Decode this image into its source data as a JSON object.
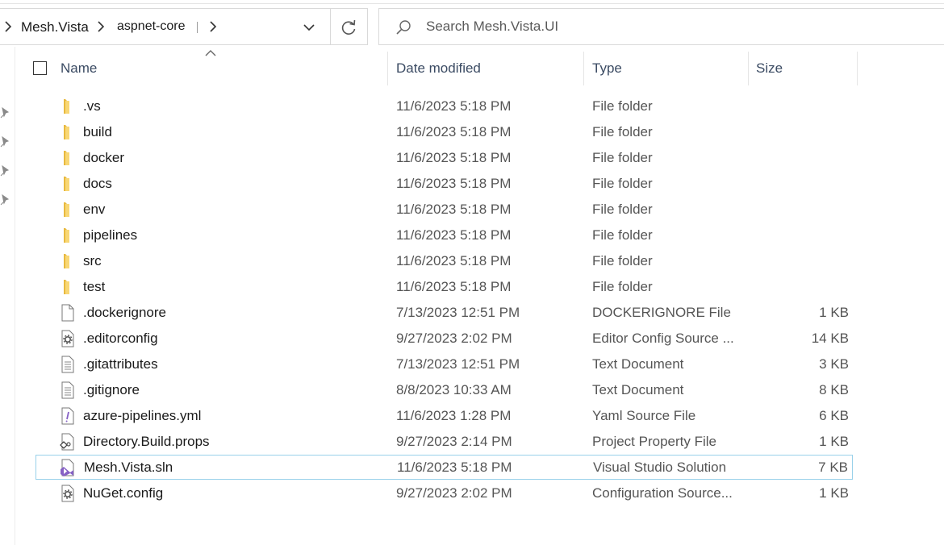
{
  "address": {
    "crumbs": [
      "Mesh.Vista",
      "aspnet-core"
    ]
  },
  "search": {
    "placeholder": "Search Mesh.Vista.UI",
    "value": ""
  },
  "columns": {
    "name": "Name",
    "date": "Date modified",
    "type": "Type",
    "size": "Size"
  },
  "files": [
    {
      "name": ".vs",
      "date": "11/6/2023 5:18 PM",
      "type": "File folder",
      "size": "",
      "icon": "folder-icon"
    },
    {
      "name": "build",
      "date": "11/6/2023 5:18 PM",
      "type": "File folder",
      "size": "",
      "icon": "folder-icon"
    },
    {
      "name": "docker",
      "date": "11/6/2023 5:18 PM",
      "type": "File folder",
      "size": "",
      "icon": "folder-icon"
    },
    {
      "name": "docs",
      "date": "11/6/2023 5:18 PM",
      "type": "File folder",
      "size": "",
      "icon": "folder-icon"
    },
    {
      "name": "env",
      "date": "11/6/2023 5:18 PM",
      "type": "File folder",
      "size": "",
      "icon": "folder-icon"
    },
    {
      "name": "pipelines",
      "date": "11/6/2023 5:18 PM",
      "type": "File folder",
      "size": "",
      "icon": "folder-icon"
    },
    {
      "name": "src",
      "date": "11/6/2023 5:18 PM",
      "type": "File folder",
      "size": "",
      "icon": "folder-icon"
    },
    {
      "name": "test",
      "date": "11/6/2023 5:18 PM",
      "type": "File folder",
      "size": "",
      "icon": "folder-icon"
    },
    {
      "name": ".dockerignore",
      "date": "7/13/2023 12:51 PM",
      "type": "DOCKERIGNORE File",
      "size": "1 KB",
      "icon": "blank-file-icon"
    },
    {
      "name": ".editorconfig",
      "date": "9/27/2023 2:02 PM",
      "type": "Editor Config Source ...",
      "size": "14 KB",
      "icon": "config-file-icon"
    },
    {
      "name": ".gitattributes",
      "date": "7/13/2023 12:51 PM",
      "type": "Text Document",
      "size": "3 KB",
      "icon": "text-file-icon"
    },
    {
      "name": ".gitignore",
      "date": "8/8/2023 10:33 AM",
      "type": "Text Document",
      "size": "8 KB",
      "icon": "text-file-icon"
    },
    {
      "name": "azure-pipelines.yml",
      "date": "11/6/2023 1:28 PM",
      "type": "Yaml Source File",
      "size": "6 KB",
      "icon": "yaml-file-icon"
    },
    {
      "name": "Directory.Build.props",
      "date": "9/27/2023 2:14 PM",
      "type": "Project Property File",
      "size": "1 KB",
      "icon": "props-file-icon"
    },
    {
      "name": "Mesh.Vista.sln",
      "date": "11/6/2023 5:18 PM",
      "type": "Visual Studio Solution",
      "size": "7 KB",
      "icon": "visual-studio-solution-icon"
    },
    {
      "name": "NuGet.config",
      "date": "9/27/2023 2:02 PM",
      "type": "Configuration Source...",
      "size": "1 KB",
      "icon": "config-file-icon"
    }
  ],
  "selected_file": "Mesh.Vista.sln",
  "colors": {
    "folder": "#F8D775",
    "selection_border": "#99D1EA",
    "header_text": "#3B4B63",
    "vs_purple": "#8661C5"
  }
}
